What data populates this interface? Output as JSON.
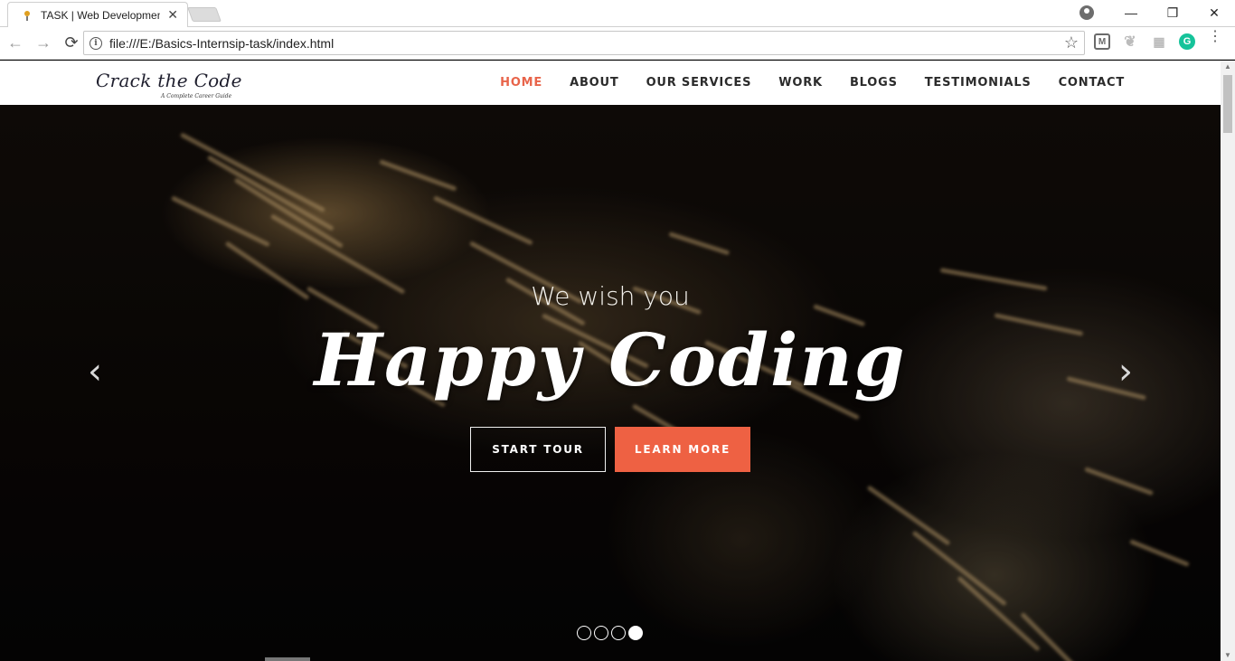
{
  "browser": {
    "tab_title": "TASK | Web Development",
    "url": "file:///E:/Basics-Internsip-task/index.html",
    "window_controls": {
      "minimize": "—",
      "restore": "❐",
      "close": "✕"
    }
  },
  "site": {
    "logo_main": "Crack the Code",
    "logo_sub": "A Complete Career Guide",
    "menu": [
      {
        "label": "HOME",
        "active": true
      },
      {
        "label": "ABOUT"
      },
      {
        "label": "OUR SERVICES"
      },
      {
        "label": "WORK"
      },
      {
        "label": "BLOGS"
      },
      {
        "label": "TESTIMONIALS"
      },
      {
        "label": "CONTACT"
      }
    ]
  },
  "hero": {
    "subtitle": "We wish you",
    "title": "Happy Coding",
    "buttons": {
      "start_tour": "START TOUR",
      "learn_more": "LEARN MORE"
    },
    "arrows": {
      "prev": "‹",
      "next": "›"
    },
    "slides": {
      "count": 4,
      "active_index": 3
    }
  },
  "colors": {
    "accent": "#ee6143",
    "active_menu": "#e8644a"
  }
}
